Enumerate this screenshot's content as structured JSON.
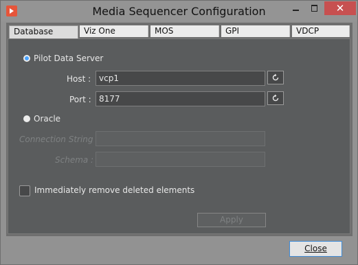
{
  "window": {
    "title": "Media Sequencer Configuration",
    "close_glyph": "✕"
  },
  "tabs": [
    {
      "label": "Database",
      "active": true
    },
    {
      "label": "Viz One"
    },
    {
      "label": "MOS"
    },
    {
      "label": "GPI"
    },
    {
      "label": "VDCP"
    }
  ],
  "database": {
    "pilot_option_label": "Pilot Data Server",
    "pilot_selected": true,
    "host_label": "Host :",
    "host_value": "vcp1",
    "port_label": "Port :",
    "port_value": "8177",
    "oracle_option_label": "Oracle",
    "connection_label": "Connection String :",
    "connection_value": "",
    "schema_label": "Schema :",
    "schema_value": "",
    "remove_deleted_label": "Immediately remove deleted elements",
    "remove_deleted_checked": false,
    "apply_label": "Apply"
  },
  "footer": {
    "close_label": "Close"
  },
  "colors": {
    "accent": "#4aa3ff",
    "panel": "#5a5c5d",
    "close_button": "#c75050"
  }
}
